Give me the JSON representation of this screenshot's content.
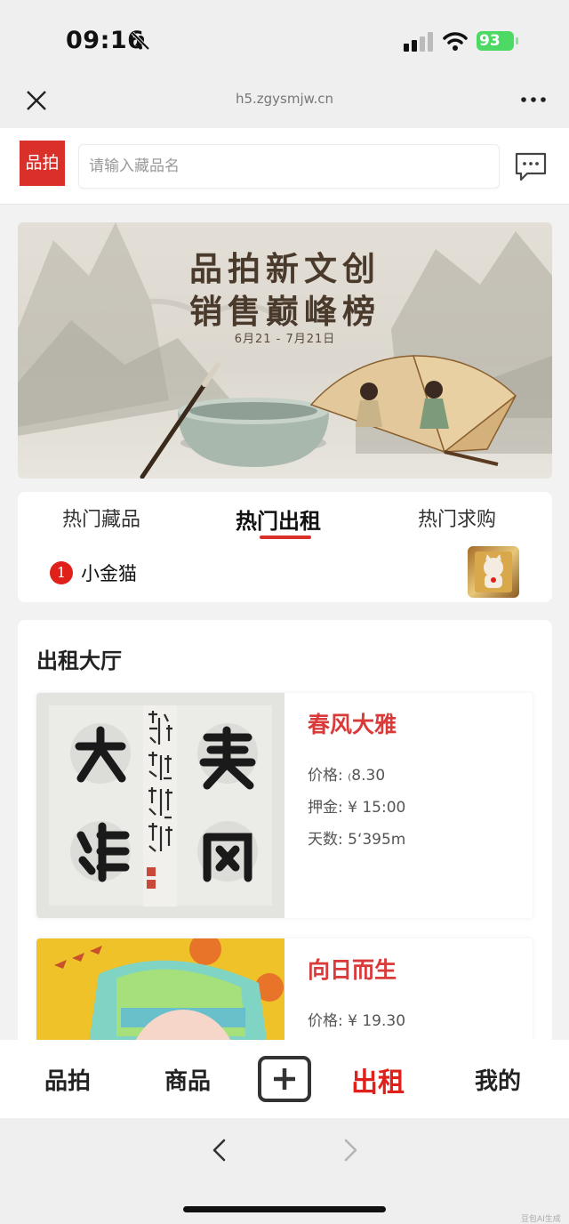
{
  "status": {
    "time": "09:16",
    "battery": "93"
  },
  "browser": {
    "url": "h5.zgysmjw.cn"
  },
  "header": {
    "logo": "品拍",
    "search_placeholder": "请输入藏品名"
  },
  "banner": {
    "line1": "品拍新文创",
    "line2": "销售巅峰榜",
    "date": "6月21 - 7月21日"
  },
  "tabs": {
    "items": [
      "热门藏品",
      "热门出租",
      "热门求购"
    ],
    "active": "热门出租"
  },
  "ranking": {
    "rank": "1",
    "name": "小金猫"
  },
  "hall": {
    "title": "出租大厅",
    "cards": [
      {
        "title": "春风大雅",
        "price": "价格: ₍8.30",
        "deposit": "押金: ¥ 15:00",
        "days": "天数: 5‘395m"
      },
      {
        "title": "向日而生",
        "price": "价格: ¥ 19.30"
      }
    ]
  },
  "tabbar": {
    "items": [
      "品拍",
      "商品",
      "出租",
      "我的"
    ],
    "active": "出租"
  },
  "watermark": "豆包AI生成",
  "colors": {
    "brand_red": "#d9302a",
    "card_title": "#d93a3a",
    "battery_green": "#4cd964"
  }
}
